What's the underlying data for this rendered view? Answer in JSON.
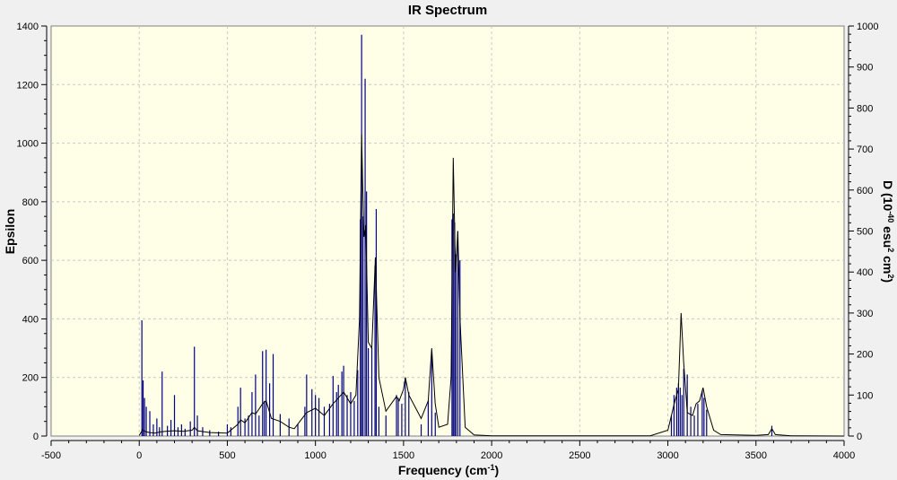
{
  "chart_data": {
    "type": "line",
    "title": "IR Spectrum",
    "xlabel": {
      "base": "Frequency (cm",
      "sup": "-1",
      "end": ")"
    },
    "ylabel": "Epsilon",
    "y2label": {
      "p1": "D (10",
      "sup1": "-40",
      "p2": " esu",
      "sup2": "2",
      "p3": " cm",
      "sup3": "2",
      "p4": ")"
    },
    "xlim": [
      -500,
      4000
    ],
    "ylim": [
      0,
      1400
    ],
    "y2lim": [
      0,
      1000
    ],
    "grid": true,
    "x_ticks": [
      -500,
      0,
      500,
      1000,
      1500,
      2000,
      2500,
      3000,
      3500,
      4000
    ],
    "y_ticks": [
      0,
      200,
      400,
      600,
      800,
      1000,
      1200,
      1400
    ],
    "y2_ticks": [
      0,
      100,
      200,
      300,
      400,
      500,
      600,
      700,
      800,
      900,
      1000
    ],
    "spectrum_color": "#000000",
    "stick_color": "#000080",
    "plot_background": "#ffffe8",
    "series": [
      {
        "kind": "spectrum",
        "x": [
          0,
          10,
          18,
          25,
          40,
          60,
          90,
          120,
          150,
          200,
          250,
          300,
          313,
          330,
          400,
          500,
          560,
          575,
          600,
          640,
          660,
          700,
          720,
          750,
          800,
          850,
          880,
          950,
          1000,
          1050,
          1100,
          1130,
          1160,
          1200,
          1230,
          1250,
          1262,
          1275,
          1285,
          1300,
          1320,
          1340,
          1360,
          1400,
          1460,
          1475,
          1500,
          1510,
          1530,
          1600,
          1640,
          1660,
          1680,
          1700,
          1750,
          1770,
          1782,
          1795,
          1808,
          1820,
          1850,
          1900,
          2000,
          2500,
          2900,
          3000,
          3020,
          3040,
          3060,
          3075,
          3090,
          3110,
          3140,
          3160,
          3180,
          3200,
          3220,
          3260,
          3300,
          3500,
          3570,
          3590,
          3610,
          3700,
          4000
        ],
        "y": [
          2,
          12,
          22,
          18,
          14,
          12,
          10,
          14,
          16,
          18,
          16,
          20,
          30,
          18,
          12,
          10,
          40,
          55,
          45,
          80,
          75,
          110,
          120,
          60,
          50,
          30,
          25,
          80,
          95,
          70,
          110,
          130,
          150,
          110,
          140,
          400,
          1030,
          680,
          720,
          320,
          300,
          610,
          200,
          85,
          135,
          120,
          160,
          200,
          140,
          60,
          120,
          300,
          110,
          30,
          40,
          200,
          950,
          560,
          700,
          400,
          30,
          4,
          1,
          1,
          1,
          20,
          70,
          120,
          160,
          420,
          250,
          80,
          70,
          110,
          120,
          165,
          100,
          20,
          5,
          2,
          5,
          25,
          5,
          1,
          0
        ]
      },
      {
        "kind": "sticks",
        "x": [
          15,
          22,
          30,
          40,
          60,
          80,
          100,
          115,
          130,
          160,
          180,
          200,
          220,
          240,
          260,
          290,
          313,
          330,
          360,
          400,
          450,
          500,
          520,
          560,
          575,
          600,
          620,
          640,
          660,
          680,
          700,
          710,
          720,
          740,
          760,
          800,
          850,
          900,
          940,
          950,
          980,
          1000,
          1020,
          1050,
          1080,
          1100,
          1120,
          1130,
          1150,
          1160,
          1180,
          1200,
          1220,
          1240,
          1255,
          1262,
          1270,
          1282,
          1290,
          1300,
          1320,
          1338,
          1345,
          1360,
          1400,
          1460,
          1470,
          1490,
          1510,
          1530,
          1600,
          1640,
          1660,
          1680,
          1775,
          1782,
          1790,
          1797,
          1808,
          1820,
          3020,
          3035,
          3050,
          3060,
          3070,
          3080,
          3090,
          3110,
          3130,
          3150,
          3170,
          3195,
          3205,
          3220,
          3590
        ],
        "y": [
          395,
          190,
          130,
          100,
          85,
          40,
          60,
          30,
          220,
          35,
          55,
          140,
          30,
          40,
          25,
          50,
          305,
          70,
          30,
          20,
          15,
          40,
          30,
          100,
          165,
          60,
          70,
          150,
          210,
          70,
          290,
          120,
          295,
          180,
          280,
          75,
          60,
          40,
          100,
          210,
          160,
          140,
          130,
          100,
          110,
          205,
          150,
          175,
          220,
          240,
          140,
          150,
          120,
          225,
          740,
          1370,
          750,
          1220,
          835,
          300,
          300,
          580,
          775,
          100,
          70,
          140,
          130,
          110,
          200,
          150,
          40,
          120,
          280,
          80,
          740,
          760,
          730,
          620,
          700,
          600,
          70,
          140,
          165,
          180,
          165,
          140,
          230,
          210,
          100,
          70,
          110,
          155,
          130,
          90,
          35
        ]
      }
    ]
  }
}
